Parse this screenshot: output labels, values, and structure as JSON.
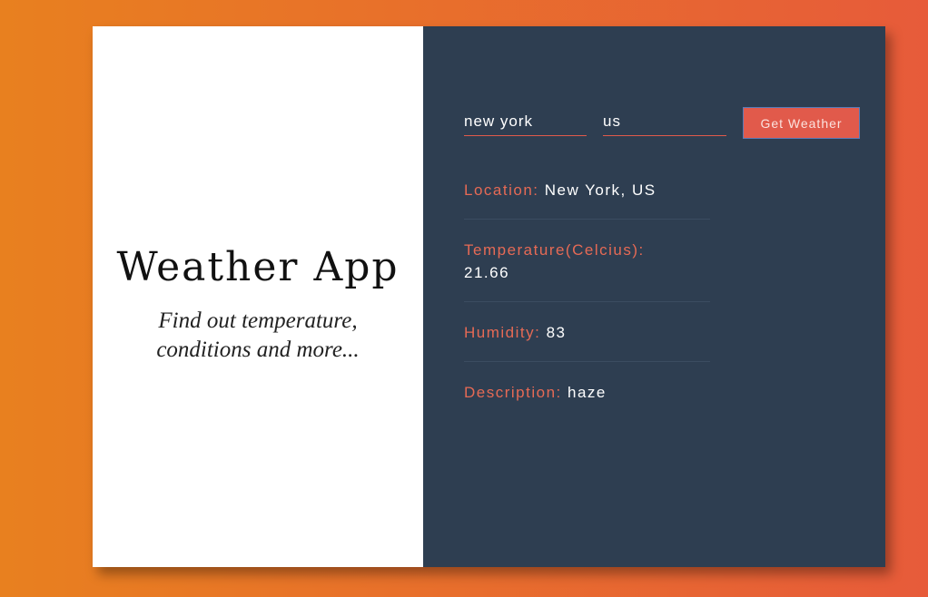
{
  "left": {
    "title": "Weather App",
    "subtitle": "Find out temperature, conditions and more..."
  },
  "form": {
    "city_value": "new york",
    "country_value": "us",
    "button_label": "Get Weather"
  },
  "results": {
    "location_label": "Location:",
    "location_value": "New York, US",
    "temperature_label": "Temperature(Celcius):",
    "temperature_value": "21.66",
    "humidity_label": "Humidity:",
    "humidity_value": "83",
    "description_label": "Description:",
    "description_value": "haze"
  },
  "colors": {
    "gradient_start": "#e8801f",
    "gradient_end": "#e75b3a",
    "panel_dark": "#2e3e51",
    "accent": "#e15a4b"
  }
}
